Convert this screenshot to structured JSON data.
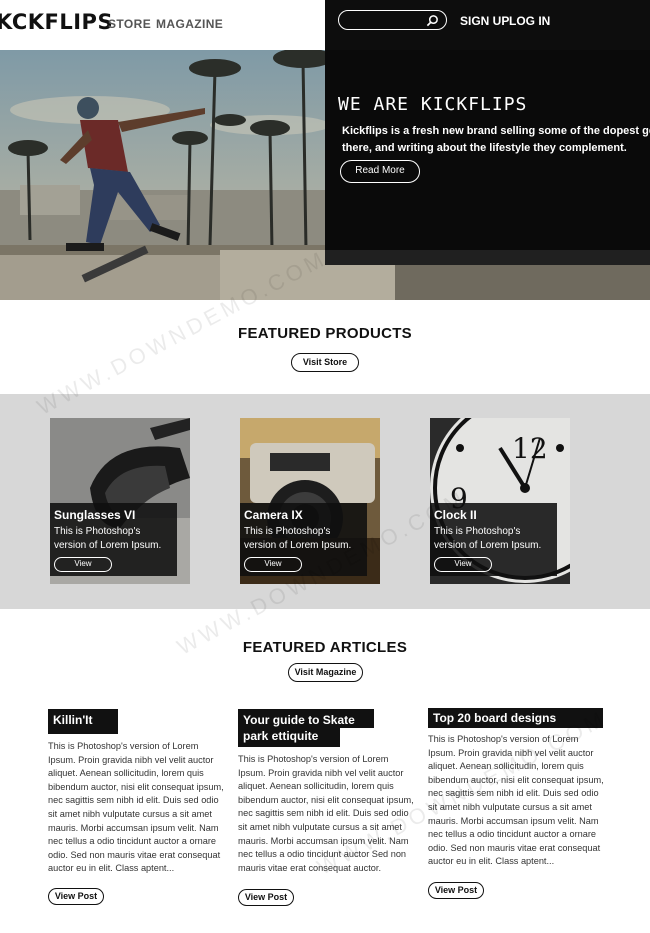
{
  "header": {
    "logo": "KCKFLIPS",
    "nav": [
      "STORE",
      "MAGAZINE"
    ],
    "search": {
      "placeholder": "",
      "value": ""
    },
    "links": [
      "SIGN UP",
      "LOG IN"
    ]
  },
  "hero": {
    "title": "WE ARE KICKFLIPS",
    "text_line1": "Kickflips is a fresh new brand selling some of the dopest gear on",
    "text_line2": "there, and writing about the lifestyle they complement.",
    "button": "Read More"
  },
  "featured_products": {
    "title": "FEATURED PRODUCTS",
    "button": "Visit Store",
    "items": [
      {
        "name": "Sunglasses VI",
        "desc": "This is Photoshop's version of Lorem Ipsum.",
        "button": "View"
      },
      {
        "name": "Camera IX",
        "desc": "This is Photoshop's version of Lorem Ipsum.",
        "button": "View"
      },
      {
        "name": "Clock II",
        "desc": "This is Photoshop's version of Lorem Ipsum.",
        "button": "View"
      }
    ]
  },
  "featured_articles": {
    "title": "FEATURED ARTICLES",
    "button": "Visit Magazine",
    "items": [
      {
        "title": "Killin'It",
        "body": "This is Photoshop's version of Lorem Ipsum. Proin gravida nibh vel velit auctor aliquet. Aenean sollicitudin, lorem quis bibendum auctor, nisi elit consequat ipsum, nec sagittis sem nibh id elit. Duis sed odio sit amet nibh vulputate cursus a sit amet mauris. Morbi accumsan ipsum velit. Nam nec tellus a odio tincidunt auctor a ornare odio. Sed non mauris vitae erat consequat auctor eu in elit. Class aptent...",
        "button": "View Post"
      },
      {
        "title_line1": "Your guide to Skate",
        "title_line2": "park ettiquite",
        "body": "This is Photoshop's version of Lorem Ipsum. Proin gravida nibh vel velit auctor aliquet. Aenean sollicitudin, lorem quis bibendum auctor, nisi elit consequat ipsum, nec sagittis sem nibh id elit. Duis sed odio sit amet nibh vulputate cursus a sit amet mauris. Morbi accumsan ipsum velit. Nam nec tellus a odio tincidunt auctor Sed non mauris vitae erat consequat auctor.",
        "button": "View Post"
      },
      {
        "title": "Top 20 board designs",
        "body": "This is Photoshop's version of Lorem Ipsum. Proin gravida nibh vel velit auctor aliquet. Aenean sollicitudin, lorem quis bibendum auctor, nisi elit consequat ipsum, nec sagittis sem nibh id elit. Duis sed odio sit amet nibh vulputate cursus a sit amet mauris. Morbi accumsan ipsum velit. Nam nec tellus a odio tincidunt auctor a ornare odio. Sed non mauris vitae erat consequat auctor eu in elit. Class aptent...",
        "button": "View Post"
      }
    ]
  },
  "watermark": "WWW.DOWNDEMO.COM"
}
